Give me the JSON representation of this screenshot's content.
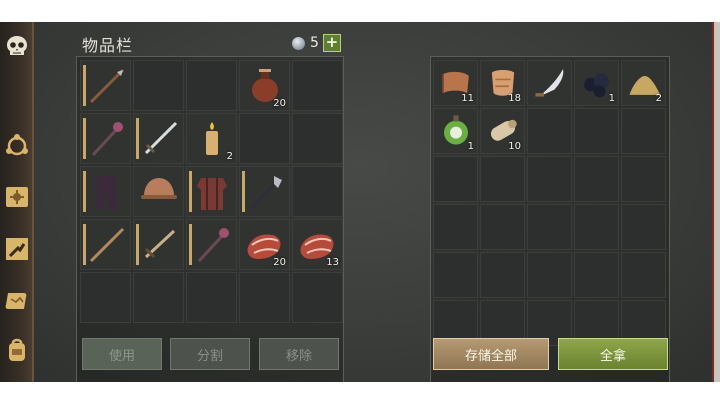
{
  "title": "物品栏",
  "currency": {
    "icon": "silver-coin-icon",
    "count": "5",
    "add_label": "+"
  },
  "sidebar": [
    {
      "name": "skull-icon"
    },
    {
      "name": "crafting-icon"
    },
    {
      "name": "sun-map-icon"
    },
    {
      "name": "build-icon"
    },
    {
      "name": "scroll-map-icon"
    },
    {
      "name": "backpack-icon"
    }
  ],
  "inventory": [
    {
      "icon": "spear-icon",
      "count": ""
    },
    {
      "icon": "",
      "count": ""
    },
    {
      "icon": "",
      "count": ""
    },
    {
      "icon": "flask-icon",
      "count": "20"
    },
    {
      "icon": "",
      "count": ""
    },
    {
      "icon": "mace-icon",
      "count": ""
    },
    {
      "icon": "sword-icon",
      "count": ""
    },
    {
      "icon": "candle-icon",
      "count": "2"
    },
    {
      "icon": "",
      "count": ""
    },
    {
      "icon": "",
      "count": ""
    },
    {
      "icon": "leather-pants-icon",
      "count": ""
    },
    {
      "icon": "helmet-icon",
      "count": ""
    },
    {
      "icon": "armor-icon",
      "count": ""
    },
    {
      "icon": "halberd-icon",
      "count": ""
    },
    {
      "icon": "",
      "count": ""
    },
    {
      "icon": "staff-icon",
      "count": ""
    },
    {
      "icon": "short-sword-icon",
      "count": ""
    },
    {
      "icon": "mace-icon",
      "count": ""
    },
    {
      "icon": "raw-meat-icon",
      "count": "20"
    },
    {
      "icon": "raw-meat-icon",
      "count": "13"
    },
    {
      "icon": "",
      "count": ""
    },
    {
      "icon": "",
      "count": ""
    },
    {
      "icon": "",
      "count": ""
    },
    {
      "icon": "",
      "count": ""
    },
    {
      "icon": "",
      "count": ""
    }
  ],
  "storage": [
    {
      "icon": "leather-scroll-icon",
      "count": "11"
    },
    {
      "icon": "hide-icon",
      "count": "18"
    },
    {
      "icon": "scimitar-icon",
      "count": ""
    },
    {
      "icon": "coal-icon",
      "count": "1"
    },
    {
      "icon": "sand-pile-icon",
      "count": "2"
    },
    {
      "icon": "poison-potion-icon",
      "count": "1"
    },
    {
      "icon": "log-icon",
      "count": "10"
    }
  ],
  "buttons": {
    "use": "使用",
    "split": "分割",
    "remove": "移除",
    "store_all": "存储全部",
    "take_all": "全拿"
  },
  "colors": {
    "accent_green": "#6b8230",
    "accent_tan": "#8f7654",
    "slot_bar": "#c8a868"
  }
}
